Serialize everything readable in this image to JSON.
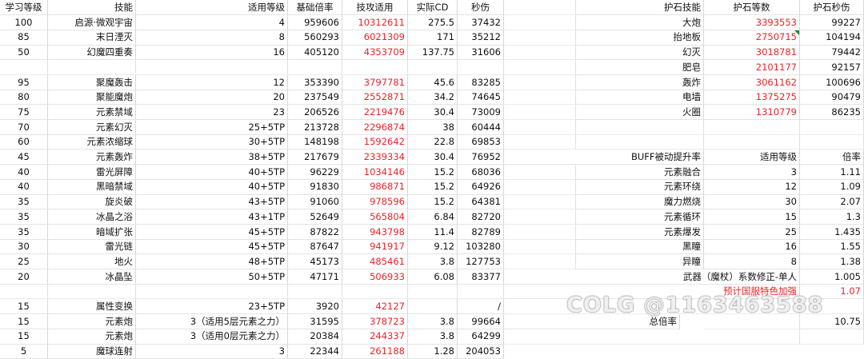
{
  "headers": {
    "learn_level": "学习等级",
    "skill": "技能",
    "apply_level": "适用等级",
    "base_rate": "基础倍率",
    "tech_attack": "技攻适用",
    "actual_cd": "实际CD",
    "dps": "秒伤",
    "guard_skill": "护石技能",
    "guard_level": "护石等数",
    "guard_dps": "护石秒伤"
  },
  "left_rows": [
    {
      "learn": "100",
      "skill": "启源·微观宇宙",
      "apply": "4",
      "base": "959606",
      "tech": "10312611",
      "cd": "275.5",
      "dps": "37432"
    },
    {
      "learn": "85",
      "skill": "末日湮灭",
      "apply": "8",
      "base": "560293",
      "tech": "6021309",
      "cd": "171",
      "dps": "35212"
    },
    {
      "learn": "50",
      "skill": "幻魔四重奏",
      "apply": "16",
      "base": "405120",
      "tech": "4353709",
      "cd": "137.75",
      "dps": "31606"
    },
    null,
    {
      "learn": "95",
      "skill": "聚魔轰击",
      "apply": "12",
      "base": "353390",
      "tech": "3797781",
      "cd": "45.6",
      "dps": "83285"
    },
    {
      "learn": "80",
      "skill": "聚能魔炮",
      "apply": "20",
      "base": "237549",
      "tech": "2552871",
      "cd": "34.2",
      "dps": "74645"
    },
    {
      "learn": "75",
      "skill": "元素禁域",
      "apply": "23",
      "base": "206526",
      "tech": "2219476",
      "cd": "30.4",
      "dps": "73009"
    },
    {
      "learn": "70",
      "skill": "元素幻灭",
      "apply": "25+5TP",
      "base": "213728",
      "tech": "2296874",
      "cd": "38",
      "dps": "60444"
    },
    {
      "learn": "60",
      "skill": "元素浓缩球",
      "apply": "30+5TP",
      "base": "148198",
      "tech": "1592642",
      "cd": "22.8",
      "dps": "69853"
    },
    {
      "learn": "45",
      "skill": "元素轰炸",
      "apply": "38+5TP",
      "base": "217679",
      "tech": "2339334",
      "cd": "30.4",
      "dps": "76952"
    },
    {
      "learn": "40",
      "skill": "雷光屏障",
      "apply": "40+5TP",
      "base": "96229",
      "tech": "1034146",
      "cd": "15.2",
      "dps": "68036"
    },
    {
      "learn": "40",
      "skill": "黑暗禁域",
      "apply": "40+5TP",
      "base": "91830",
      "tech": "986871",
      "cd": "15.2",
      "dps": "64926"
    },
    {
      "learn": "35",
      "skill": "旋炎破",
      "apply": "43+5TP",
      "base": "91060",
      "tech": "978596",
      "cd": "15.2",
      "dps": "64381"
    },
    {
      "learn": "35",
      "skill": "冰晶之浴",
      "apply": "43+1TP",
      "base": "52649",
      "tech": "565804",
      "cd": "6.84",
      "dps": "82720"
    },
    {
      "learn": "35",
      "skill": "暗域扩张",
      "apply": "45+5TP",
      "base": "87822",
      "tech": "943798",
      "cd": "11.4",
      "dps": "82789"
    },
    {
      "learn": "30",
      "skill": "雷光链",
      "apply": "45+5TP",
      "base": "87647",
      "tech": "941917",
      "cd": "9.12",
      "dps": "103280"
    },
    {
      "learn": "25",
      "skill": "地火",
      "apply": "48+5TP",
      "base": "45173",
      "tech": "485461",
      "cd": "3.8",
      "dps": "127753"
    },
    {
      "learn": "20",
      "skill": "冰晶坠",
      "apply": "50+5TP",
      "base": "47171",
      "tech": "506933",
      "cd": "6.08",
      "dps": "83377"
    },
    null,
    {
      "learn": "15",
      "skill": "属性变换",
      "apply": "23+5TP",
      "base": "3920",
      "tech": "42127",
      "cd": "",
      "dps": "/"
    },
    {
      "learn": "15",
      "skill": "元素炮",
      "apply": "3（适用5层元素之力）",
      "base": "31595",
      "tech": "378723",
      "cd": "3.8",
      "dps": "99664"
    },
    {
      "learn": "15",
      "skill": "元素炮",
      "apply": "3（适用0层元素之力）",
      "base": "20384",
      "tech": "244337",
      "cd": "3.8",
      "dps": "64299"
    },
    {
      "learn": "5",
      "skill": "魔球连射",
      "apply": "3",
      "base": "22344",
      "tech": "261188",
      "cd": "1.28",
      "dps": "204053"
    }
  ],
  "guard_rows": [
    {
      "skill": "大炮",
      "level": "3393553",
      "dps": "99227"
    },
    {
      "skill": "抬地板",
      "level": "2750715",
      "dps": "104194"
    },
    {
      "skill": "幻灭",
      "level": "3018781",
      "dps": "79442"
    },
    {
      "skill": "肥皂",
      "level": "2101177",
      "dps": "92157"
    },
    {
      "skill": "轰炸",
      "level": "3061162",
      "dps": "100696"
    },
    {
      "skill": "电墙",
      "level": "1375275",
      "dps": "90479"
    },
    {
      "skill": "火圈",
      "level": "1310779",
      "dps": "86235"
    }
  ],
  "buff_headers": {
    "title": "BUFF被动提升率",
    "apply_level": "适用等级",
    "rate": "倍率"
  },
  "buff_rows": [
    {
      "name": "元素融合",
      "level": "3",
      "rate": "1.11"
    },
    {
      "name": "元素环绕",
      "level": "12",
      "rate": "1.09"
    },
    {
      "name": "魔力燃烧",
      "level": "30",
      "rate": "2.07"
    },
    {
      "name": "元素循环",
      "level": "15",
      "rate": "1.3"
    },
    {
      "name": "元素爆发",
      "level": "25",
      "rate": "1.435"
    },
    {
      "name": "黑瞳",
      "level": "16",
      "rate": "1.55"
    },
    {
      "name": "异瞳",
      "level": "8",
      "rate": "1.38"
    }
  ],
  "weapon_row": {
    "label": "武器（魔杖）系数修正-单人",
    "rate": "1.005"
  },
  "server_row": {
    "label": "预计国服特色加强",
    "rate": "1.07"
  },
  "total_row": {
    "label": "总倍率",
    "rate": "10.75"
  },
  "watermark": {
    "brand": "COLG",
    "at": "@",
    "user": "1163463588"
  },
  "colors": {
    "red": "#e4262c",
    "grid": "#d8d8d8",
    "marker": "#1f8a3b"
  }
}
